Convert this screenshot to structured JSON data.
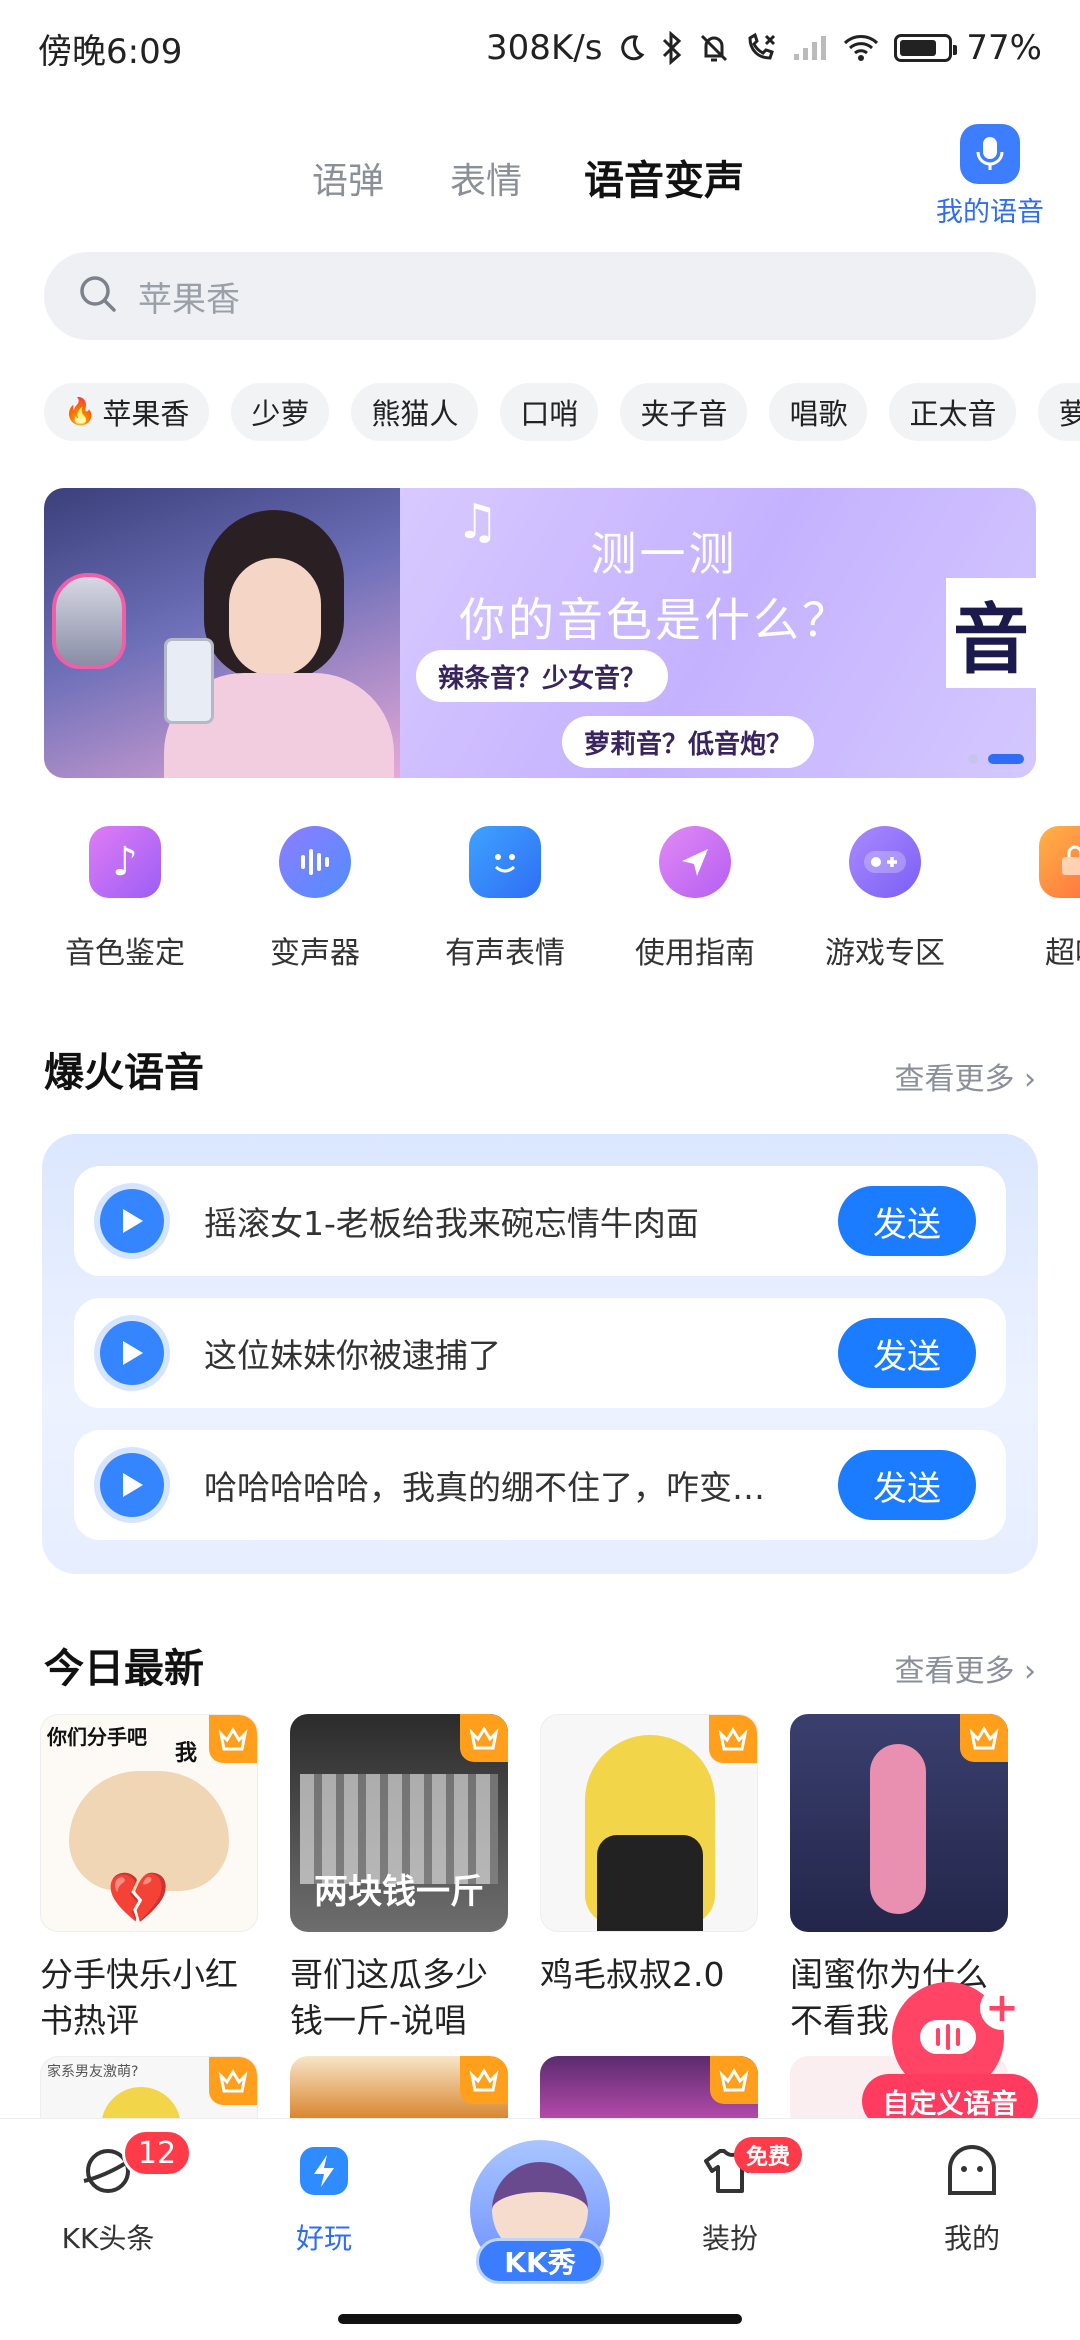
{
  "status_bar": {
    "time": "傍晚6:09",
    "net_speed": "308K/s",
    "battery": "77%",
    "battery_level": 0.77
  },
  "top_tabs": [
    {
      "label": "语弹"
    },
    {
      "label": "表情"
    },
    {
      "label": "语音变声",
      "active": true
    }
  ],
  "my_voice_label": "我的语音",
  "search": {
    "placeholder": "苹果香"
  },
  "chips": [
    "苹果香",
    "少萝",
    "熊猫人",
    "口哨",
    "夹子音",
    "唱歌",
    "正太音",
    "萝"
  ],
  "banner": {
    "title_line1": "测一测",
    "title_line2": "你的音色是什么？",
    "tag1": "辣条音？少女音？",
    "tag2": "萝莉音？低音炮？",
    "big_char": "音",
    "note": "♫"
  },
  "quick_actions": [
    {
      "label": "音色鉴定",
      "icon": "music-note-user-icon",
      "color": "#b86bf5"
    },
    {
      "label": "变声器",
      "icon": "voice-wave-bubble-icon",
      "color": "#6b7cff"
    },
    {
      "label": "有声表情",
      "icon": "sound-emoji-icon",
      "color": "#2f8cff"
    },
    {
      "label": "使用指南",
      "icon": "navigation-arrow-icon",
      "color": "#c45ef2"
    },
    {
      "label": "游戏专区",
      "icon": "gamepad-icon",
      "color": "#8b6bf5"
    },
    {
      "label": "超哆",
      "icon": "gift-bag-icon",
      "color": "#ff8a2a"
    }
  ],
  "hot_section": {
    "title": "爆火语音",
    "more": "查看更多 ›",
    "items": [
      {
        "text": "摇滚女1-老板给我来碗忘情牛肉面",
        "send": "发送"
      },
      {
        "text": "这位妹妹你被逮捕了",
        "send": "发送"
      },
      {
        "text": "哈哈哈哈哈，我真的绷不住了，咋变…",
        "send": "发送"
      }
    ]
  },
  "today_section": {
    "title": "今日最新",
    "more": "查看更多 ›",
    "tiles": [
      {
        "name": "分手快乐小红书热评",
        "thumb_text": "你们分手吧",
        "thumb_text2": "我"
      },
      {
        "name": "哥们这瓜多少钱一斤-说唱",
        "thumb_text": "两块钱一斤"
      },
      {
        "name": "鸡毛叔叔2.0"
      },
      {
        "name": "闺蜜你为什么不看我"
      }
    ],
    "row2_thumb_text": "家系男友激萌?"
  },
  "fab": {
    "label": "自定义语音"
  },
  "bottom_nav": [
    {
      "label": "KK头条",
      "badge": "12"
    },
    {
      "label": "好玩",
      "active": true
    },
    {
      "label": "KK秀"
    },
    {
      "label": "装扮",
      "badge": "免费"
    },
    {
      "label": "我的"
    }
  ],
  "colors": {
    "accent": "#2f6df5",
    "send": "#1b7cff",
    "highlight": "#ffd21f",
    "fab": "#ff3c5f"
  }
}
